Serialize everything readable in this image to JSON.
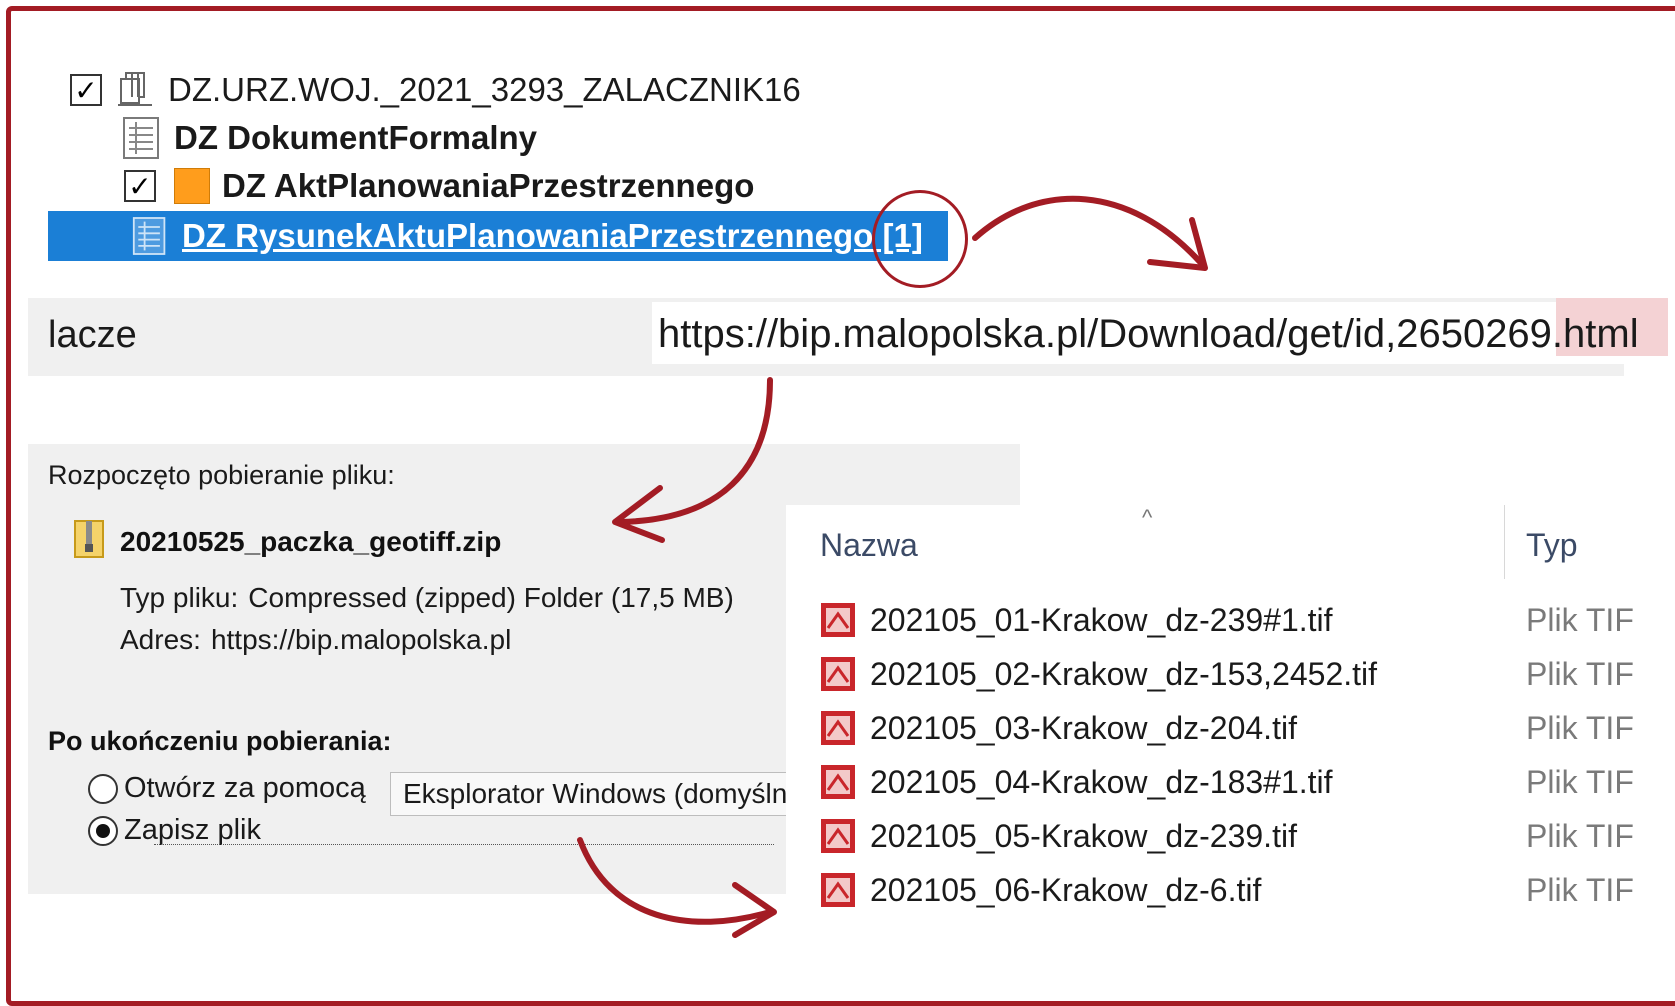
{
  "tree": {
    "items": [
      {
        "label": "DZ.URZ.WOJ._2021_3293_ZALACZNIK16",
        "checked": true,
        "icon": "package-icon"
      },
      {
        "label": "DZ DokumentFormalny",
        "icon": "document-list-icon"
      },
      {
        "label": "DZ AktPlanowaniaPrzestrzennego",
        "checked": true,
        "icon": "orange-square-icon"
      },
      {
        "label": "DZ RysunekAktuPlanowaniaPrzestrzennego [1]",
        "selected": true,
        "icon": "document-list-icon"
      }
    ]
  },
  "link": {
    "label": "lacze",
    "value": "https://bip.malopolska.pl/Download/get/id,2650269.html"
  },
  "download": {
    "started_text": "Rozpoczęto pobieranie pliku:",
    "file_name": "20210525_paczka_geotiff.zip",
    "type_key": "Typ pliku:",
    "type_value": "Compressed (zipped) Folder (17,5 MB)",
    "address_key": "Adres:",
    "address_value": "https://bip.malopolska.pl",
    "after_title": "Po ukończeniu pobierania:",
    "open_with_label": "Otwórz za pomocą",
    "open_with_value": "Eksplorator Windows (domyśln",
    "save_label": "Zapisz plik"
  },
  "files": {
    "col_name": "Nazwa",
    "col_type": "Typ",
    "sort_arrow": "^",
    "rows": [
      {
        "name": "202105_01-Krakow_dz-239#1.tif",
        "type": "Plik TIF"
      },
      {
        "name": "202105_02-Krakow_dz-153,2452.tif",
        "type": "Plik TIF"
      },
      {
        "name": "202105_03-Krakow_dz-204.tif",
        "type": "Plik TIF"
      },
      {
        "name": "202105_04-Krakow_dz-183#1.tif",
        "type": "Plik TIF"
      },
      {
        "name": "202105_05-Krakow_dz-239.tif",
        "type": "Plik TIF"
      },
      {
        "name": "202105_06-Krakow_dz-6.tif",
        "type": "Plik TIF"
      }
    ]
  },
  "colors": {
    "annotation": "#a31c24",
    "selection": "#1b7fd6",
    "panel": "#f0f0f0",
    "highlight": "#f4d2d4"
  }
}
